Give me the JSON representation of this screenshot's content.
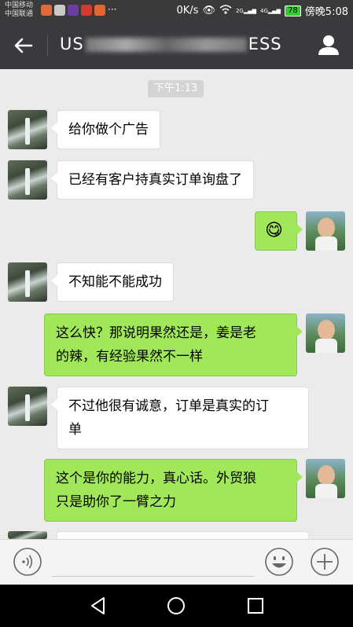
{
  "status_bar": {
    "carrier1": "中国移动",
    "carrier2": "中国联通",
    "speed": "0K/s",
    "signal1": "2G",
    "signal2": "4G",
    "battery": "78",
    "time": "傍晚5:08"
  },
  "header": {
    "title_prefix": "US",
    "title_suffix": "ESS",
    "back_icon": "arrow-left-icon",
    "profile_icon": "person-icon"
  },
  "chat": {
    "timestamp": "下午1:13",
    "messages": [
      {
        "side": "left",
        "text": "给你做个广告"
      },
      {
        "side": "left",
        "text": "已经有客户持真实订单询盘了"
      },
      {
        "side": "right",
        "text": "😋"
      },
      {
        "side": "left",
        "text": "不知能不能成功"
      },
      {
        "side": "right",
        "line1": "这么快？那说明果然还是，姜是老",
        "line2": "的辣，有经验果然不一样"
      },
      {
        "side": "left",
        "line1": "不过他很有诚意，订单是真实的订",
        "line2": "单"
      },
      {
        "side": "right",
        "line1": "这个是你的能力，真心话。外贸狼",
        "line2": "只是助你了一臂之力"
      }
    ]
  },
  "input_bar": {
    "voice_icon": "voice-icon",
    "emoji_icon": "emoji-icon",
    "plus_icon": "plus-icon"
  },
  "nav_bar": {
    "back_icon": "nav-back-icon",
    "home_icon": "nav-home-icon",
    "recent_icon": "nav-recent-icon"
  },
  "colors": {
    "header_bg": "#393a3f",
    "chat_bg": "#ebebeb",
    "sent_bubble": "#a0e75a",
    "received_bubble": "#ffffff"
  }
}
